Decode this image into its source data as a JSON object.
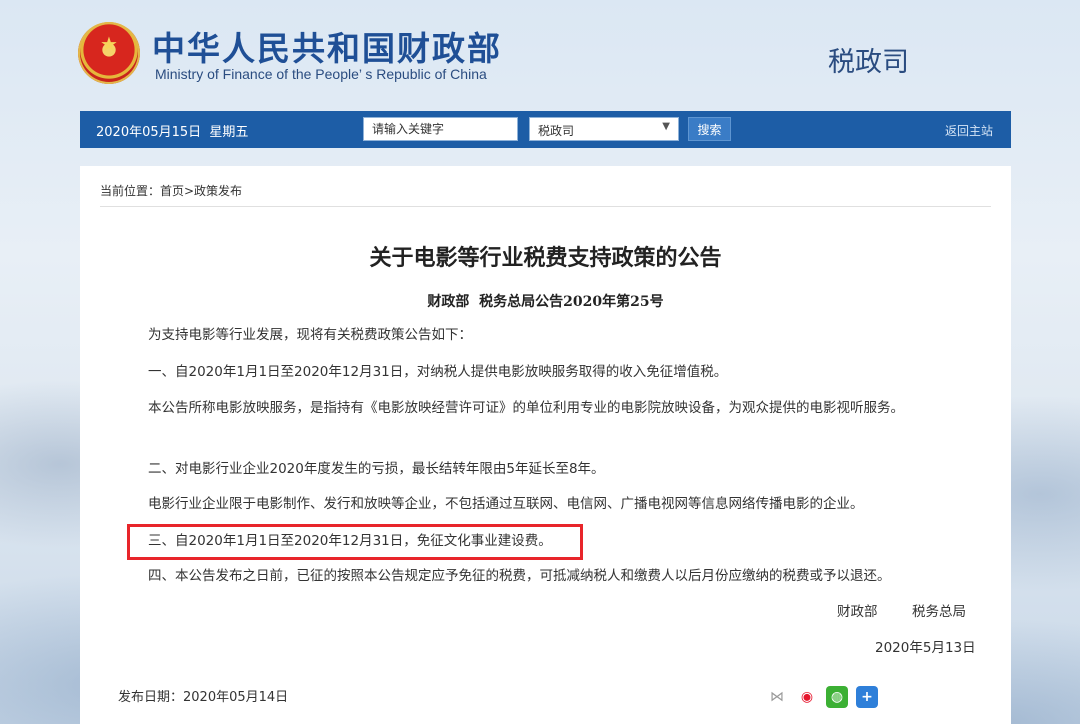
{
  "header": {
    "ministry_cn": "中华人民共和国财政部",
    "ministry_en": "Ministry of Finance of the People’ s Republic of China",
    "department": "税政司"
  },
  "navbar": {
    "date": "2020年05月15日  星期五",
    "search_placeholder": "请输入关键字",
    "select_value": "税政司",
    "search_button": "搜索",
    "back_home": "返回主站"
  },
  "breadcrumb": "当前位置：首页>政策发布",
  "article": {
    "title": "关于电影等行业税费支持政策的公告",
    "doc_number": "财政部  税务总局公告2020年第25号",
    "paragraphs": [
      "为支持电影等行业发展，现将有关税费政策公告如下：",
      "一、自2020年1月1日至2020年12月31日，对纳税人提供电影放映服务取得的收入免征增值税。",
      "本公告所称电影放映服务，是指持有《电影放映经营许可证》的单位利用专业的电影院放映设备，为观众提供的电影视听服务。",
      "二、对电影行业企业2020年度发生的亏损，最长结转年限由5年延长至8年。",
      "电影行业企业限于电影制作、发行和放映等企业，不包括通过互联网、电信网、广播电视网等信息网络传播电影的企业。",
      "三、自2020年1月1日至2020年12月31日，免征文化事业建设费。",
      "四、本公告发布之日前，已征的按照本公告规定应予免征的税费，可抵减纳税人和缴费人以后月份应缴纳的税费或予以退还。"
    ],
    "signer_1": "财政部",
    "signer_2": "税务总局",
    "sign_date": "2020年5月13日",
    "publish_date": "发布日期：2020年05月14日"
  },
  "share_icons": [
    "share-icon",
    "weibo-icon",
    "wechat-icon",
    "plus-icon"
  ]
}
